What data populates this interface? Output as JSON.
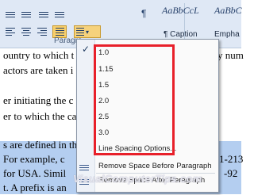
{
  "ribbon": {
    "paragraph_group_label": "Paragra",
    "pilcrow": "¶",
    "style_previews": [
      {
        "preview": "AaBbCcL",
        "name": "¶ Caption"
      },
      {
        "preview": "AaBbC",
        "name": "Empha"
      }
    ],
    "line_spacing_caret": "▾"
  },
  "document": {
    "lines": [
      "ountry to which t",
      "actors are taken i",
      "er initiating the c",
      "er to which the ca",
      "s are defined in th",
      "For example, c",
      "for USA. Simil",
      "t. A prefix is an"
    ],
    "right_fragments": [
      "y num",
      "1-213",
      "-92"
    ],
    "watermark": "VisualComputerTips.com"
  },
  "menu": {
    "checked_mark": "✓",
    "spacing_options": [
      "1.0",
      "1.15",
      "1.5",
      "2.0",
      "2.5",
      "3.0"
    ],
    "more_options": "Line Spacing Options...",
    "remove_before": "Remove Space Before Paragraph",
    "remove_after": "Remove Space After Paragraph"
  },
  "colors": {
    "ribbon_bg": "#dfe8f5",
    "highlight": "#b4cef0",
    "annotation_red": "#e8202a",
    "selected_button": "#f8cf6a"
  }
}
